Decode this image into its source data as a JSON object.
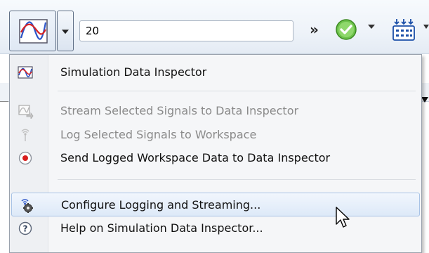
{
  "toolbar": {
    "stop_time_value": "20",
    "more_glyph": "»",
    "icons": {
      "sdi": "sdi-plot-icon",
      "run": "check-run-icon",
      "signals": "signal-table-icon"
    }
  },
  "menu": {
    "items": [
      {
        "label": "Simulation Data Inspector",
        "icon": "sdi-plot-icon",
        "enabled": true
      },
      {
        "label": "Stream Selected Signals to Data Inspector",
        "icon": "stream-icon",
        "enabled": false
      },
      {
        "label": "Log Selected Signals to Workspace",
        "icon": "log-antenna-icon",
        "enabled": false
      },
      {
        "label": "Send Logged Workspace Data to Data Inspector",
        "icon": "record-icon",
        "enabled": true
      },
      {
        "label": "Configure Logging and Streaming...",
        "icon": "configure-icon",
        "enabled": true,
        "highlighted": true
      },
      {
        "label": "Help on Simulation Data Inspector...",
        "icon": "help-icon",
        "enabled": true
      }
    ]
  },
  "colors": {
    "menu_bg": "#f5f6f8",
    "highlight_border": "#a8c3e6",
    "disabled_text": "#8a8a8a",
    "run_green": "#4caf2f",
    "record_red": "#d81e1e"
  }
}
